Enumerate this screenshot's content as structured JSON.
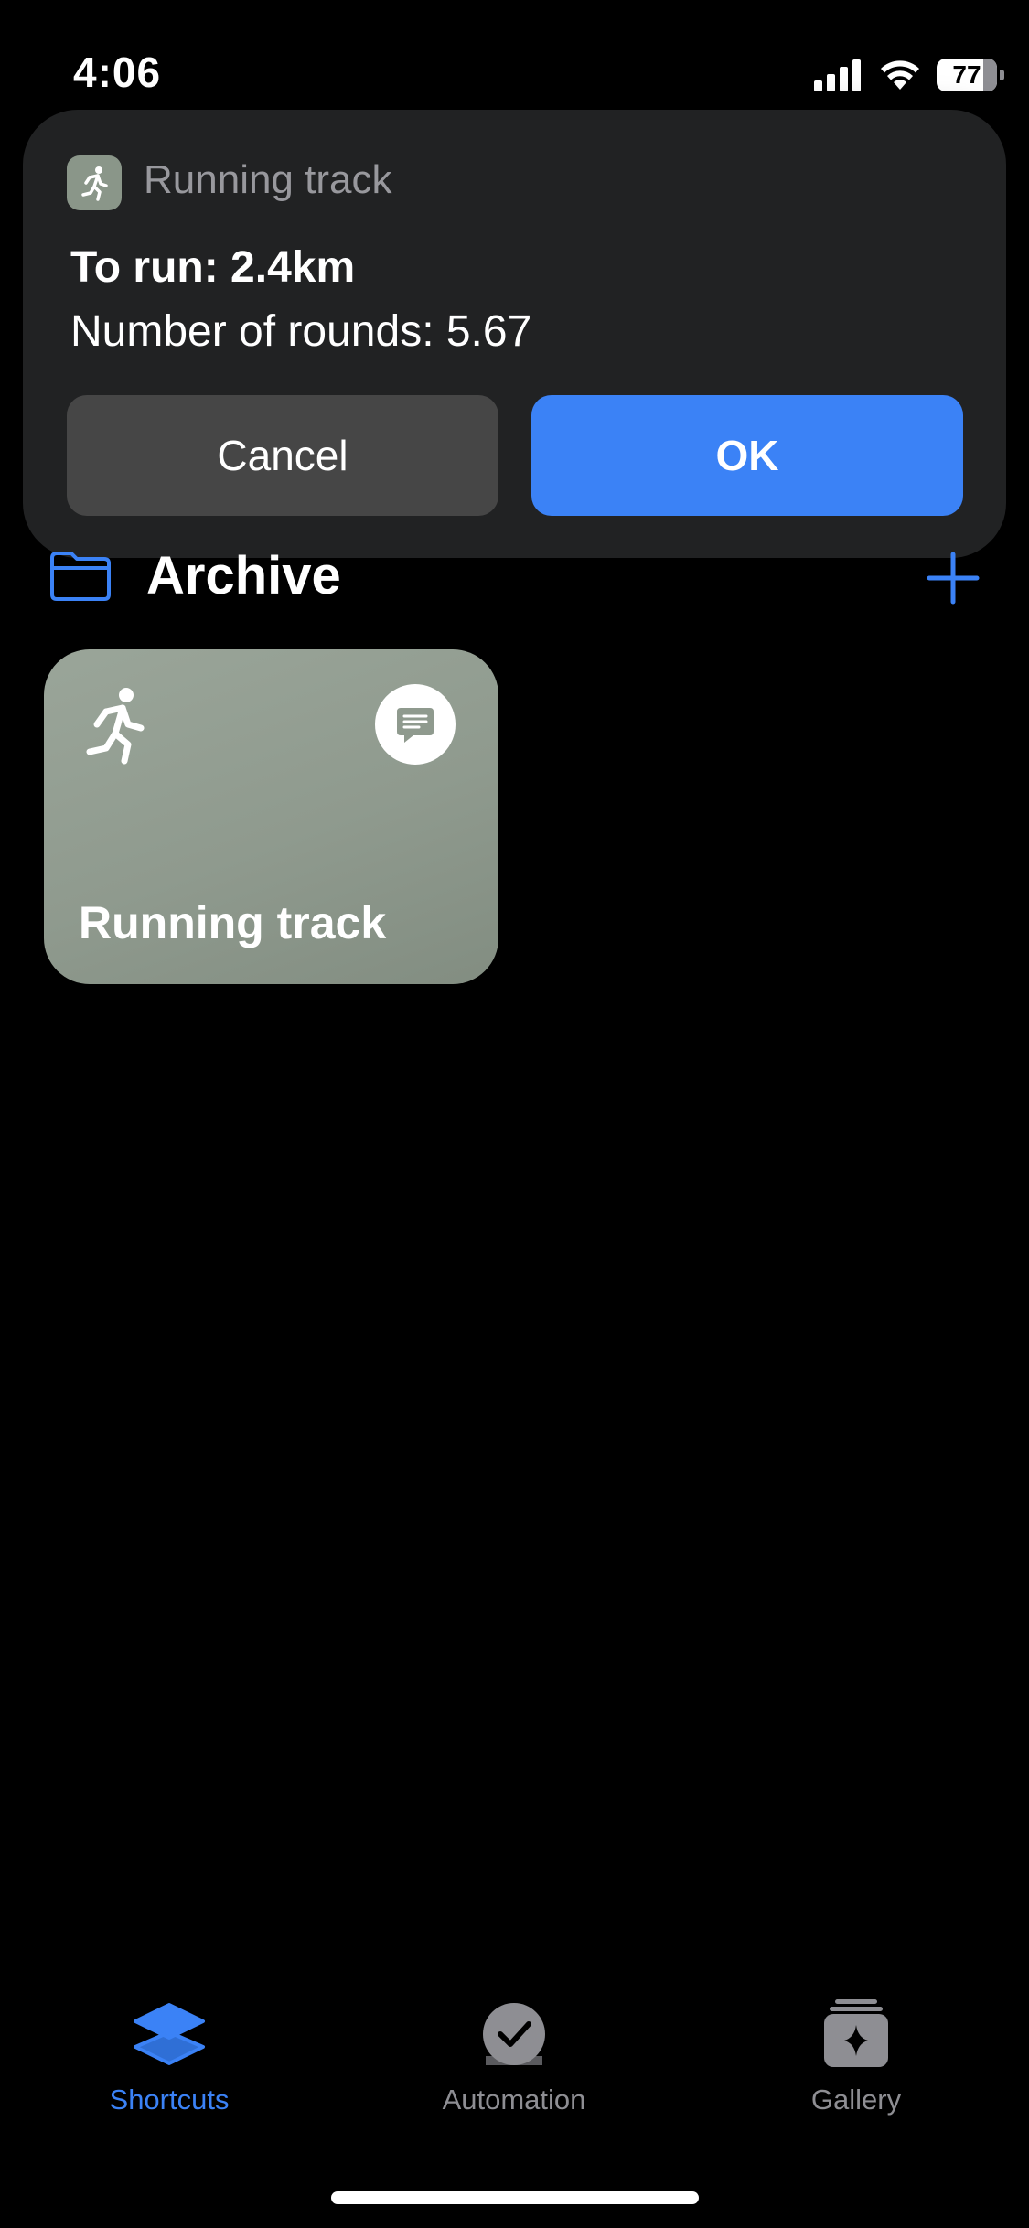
{
  "status_bar": {
    "time": "4:06",
    "battery_level": "77"
  },
  "alert": {
    "app_name": "Running track",
    "app_icon": "running-figure-icon",
    "title": "To run: 2.4km",
    "message": "Number of rounds: 5.67",
    "cancel_label": "Cancel",
    "ok_label": "OK"
  },
  "folder": {
    "title": "Archive",
    "icon": "folder-icon",
    "add_icon": "plus-icon"
  },
  "shortcut_tile": {
    "title": "Running track",
    "icon": "running-figure-icon",
    "action_icon": "speech-bubble-icon",
    "color": "#8f9a8e"
  },
  "tab_bar": {
    "tabs": [
      {
        "label": "Shortcuts",
        "icon": "stacked-layers-icon",
        "selected": true
      },
      {
        "label": "Automation",
        "icon": "checkmark-clock-icon",
        "selected": false
      },
      {
        "label": "Gallery",
        "icon": "sparkle-stack-icon",
        "selected": false
      }
    ]
  },
  "colors": {
    "accent": "#3b82f6",
    "alert_background": "#212223",
    "cancel_button": "#464646",
    "inactive_tab": "#8e8e93"
  }
}
